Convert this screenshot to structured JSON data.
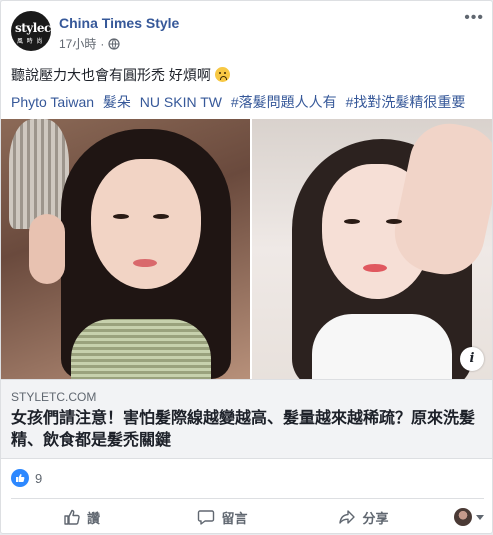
{
  "post": {
    "page_name": "China Times Style",
    "logo_text": "stylec",
    "logo_sub": "風 時 尚",
    "timestamp": "17小時",
    "more_icon": "more-dots-icon",
    "privacy_icon": "globe-icon",
    "text_line1": "聽說壓力大也會有圓形禿 好煩啊",
    "hashtags": [
      "Phyto Taiwan",
      "髮朵",
      "NU SKIN TW",
      "#落髮問題人人有",
      "#找對洗髮精很重要"
    ]
  },
  "link_preview": {
    "domain": "STYLETC.COM",
    "title": "女孩們請注意！害怕髮際線越變越高、髮量越來越稀疏？原來洗髮精、飲食都是髮禿關鍵",
    "info_label": "i"
  },
  "reactions": {
    "like_count": "9",
    "like_color": "#2d88ff"
  },
  "actions": {
    "like_label": "讚",
    "comment_label": "留言",
    "share_label": "分享"
  }
}
